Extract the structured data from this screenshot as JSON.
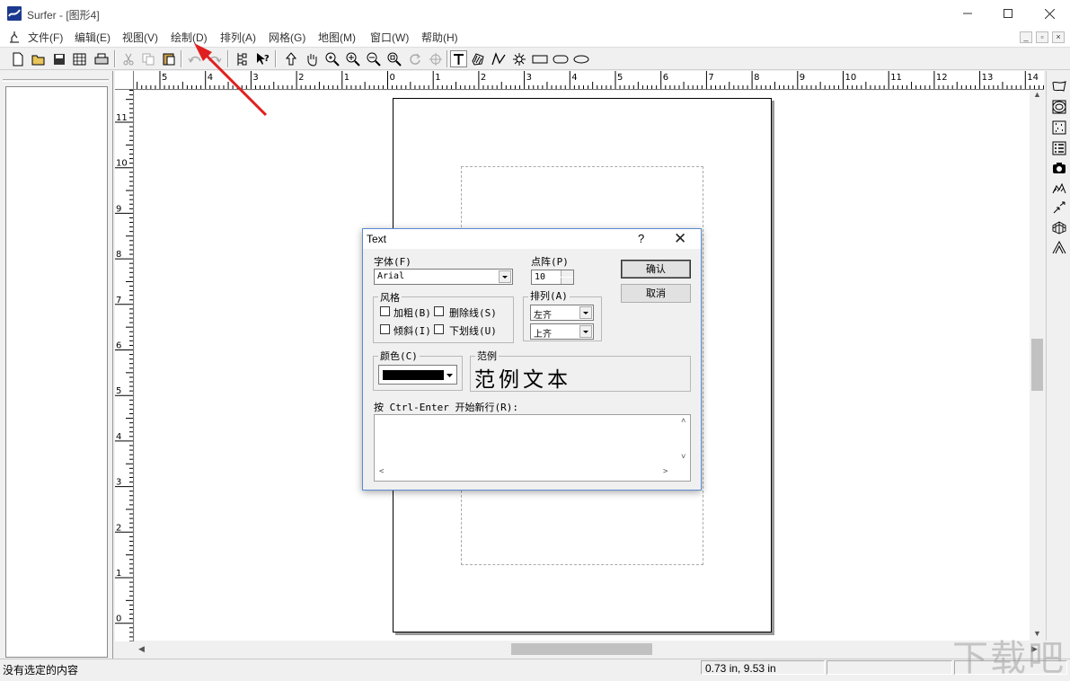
{
  "window": {
    "title": "Surfer - [图形4]"
  },
  "menu": {
    "items": [
      {
        "label": "文件(F)"
      },
      {
        "label": "编辑(E)"
      },
      {
        "label": "视图(V)"
      },
      {
        "label": "绘制(D)"
      },
      {
        "label": "排列(A)"
      },
      {
        "label": "网格(G)"
      },
      {
        "label": "地图(M)"
      },
      {
        "label": "窗口(W)"
      },
      {
        "label": "帮助(H)"
      }
    ]
  },
  "toolbar": {
    "buttons": [
      "new-icon",
      "open-icon",
      "save-icon",
      "worksheet-icon",
      "print-icon",
      "cut-icon",
      "copy-icon",
      "paste-icon",
      "undo-icon",
      "redo-icon",
      "object-manager-icon",
      "context-help-icon",
      "select-arrow-icon",
      "pan-hand-icon",
      "zoom-realtime-icon",
      "zoom-in-icon",
      "zoom-out-icon",
      "zoom-rect-icon",
      "rotate-icon",
      "reshape-icon",
      "text-tool-icon",
      "polygon-tool-icon",
      "polyline-tool-icon",
      "symbol-tool-icon",
      "rectangle-tool-icon",
      "rounded-rect-tool-icon",
      "ellipse-tool-icon"
    ]
  },
  "rulers": {
    "horizontal_labels": [
      "5",
      "4",
      "3",
      "2",
      "1",
      "0",
      "1",
      "2",
      "3",
      "4",
      "5",
      "6",
      "7",
      "8",
      "9",
      "10",
      "11",
      "12",
      "13",
      "14"
    ],
    "vertical_labels": [
      "11",
      "10",
      "9",
      "8",
      "7",
      "6",
      "5",
      "4",
      "3",
      "2",
      "1",
      "0"
    ]
  },
  "right_toolbar": {
    "buttons": [
      "base-map-icon",
      "contour-map-icon",
      "post-map-icon",
      "classed-post-icon",
      "image-map-icon",
      "shaded-relief-icon",
      "vector-map-icon",
      "wireframe-icon",
      "surface-icon"
    ]
  },
  "dialog": {
    "title": "Text",
    "help": "?",
    "font_label": "字体(F)",
    "font_value": "Arial",
    "size_label": "点阵(P)",
    "size_value": "10",
    "style_group": "风格",
    "bold_label": "加粗(B)",
    "strikeout_label": "删除线(S)",
    "italic_label": "倾斜(I)",
    "underline_label": "下划线(U)",
    "align_group": "排列(A)",
    "halign_value": "左齐",
    "valign_value": "上齐",
    "ok_label": "确认",
    "cancel_label": "取消",
    "color_group": "颜色(C)",
    "color_value": "#000000",
    "sample_group": "范例",
    "sample_text": "范例文本",
    "newline_hint": "按 Ctrl-Enter 开始新行(R):",
    "text_value": ""
  },
  "status": {
    "message": "没有选定的内容",
    "coords": "0.73 in, 9.53 in"
  },
  "watermark": "下载吧"
}
